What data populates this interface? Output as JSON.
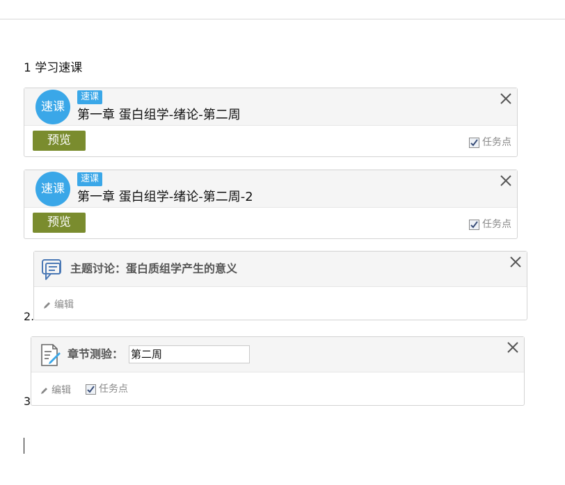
{
  "section_heading": "1 学习速课",
  "course_cards": [
    {
      "badge": "速课",
      "tag": "速课",
      "title": "第一章 蛋白组学-绪论-第二周",
      "preview_label": "预览",
      "task_point_label": "任务点",
      "task_point_checked": true
    },
    {
      "badge": "速课",
      "tag": "速课",
      "title": "第一章 蛋白组学-绪论-第二周-2",
      "preview_label": "预览",
      "task_point_label": "任务点",
      "task_point_checked": true
    }
  ],
  "discussion": {
    "number": "2.",
    "label": "主题讨论：",
    "value": "蛋白质组学产生的意义",
    "edit_label": "编辑"
  },
  "quiz": {
    "number": "3",
    "label": "章节测验：",
    "value": "第二周",
    "edit_label": "编辑",
    "task_point_label": "任务点",
    "task_point_checked": true
  },
  "colors": {
    "accent_blue": "#3aa7e8",
    "preview_green": "#7a8c2e"
  }
}
